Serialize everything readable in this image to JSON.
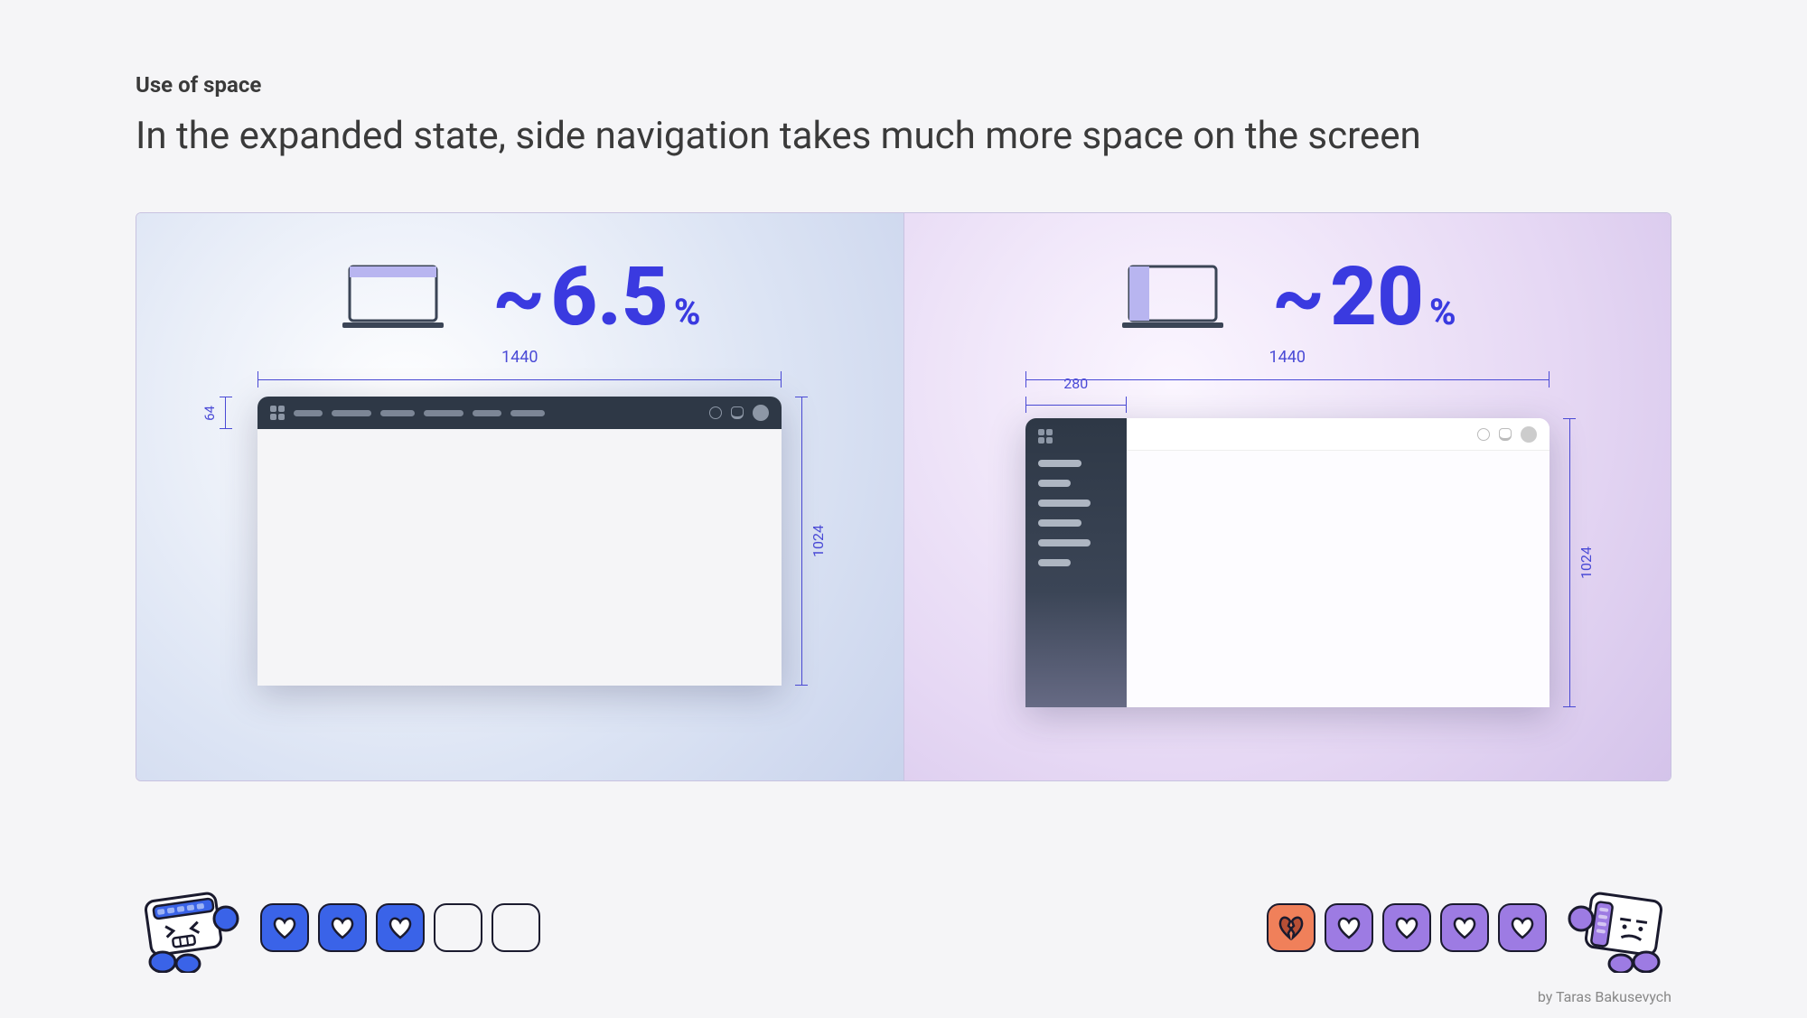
{
  "eyebrow": "Use of space",
  "headline": "In the expanded state, side navigation takes much more space on the screen",
  "left": {
    "percent_prefix": "~",
    "percent_value": "6.5",
    "percent_suffix": "%",
    "screen_width": "1440",
    "screen_height": "1024",
    "topnav_height": "64"
  },
  "right": {
    "percent_prefix": "~",
    "percent_value": "20",
    "percent_suffix": "%",
    "screen_width": "1440",
    "screen_height": "1024",
    "sidenav_width": "280"
  },
  "left_fighter": {
    "hearts_filled": 3,
    "hearts_total": 5,
    "color": "blue"
  },
  "right_fighter": {
    "hearts_filled": 4,
    "hearts_total": 5,
    "color": "purple",
    "broken": true
  },
  "credit": "by Taras Bakusevych"
}
